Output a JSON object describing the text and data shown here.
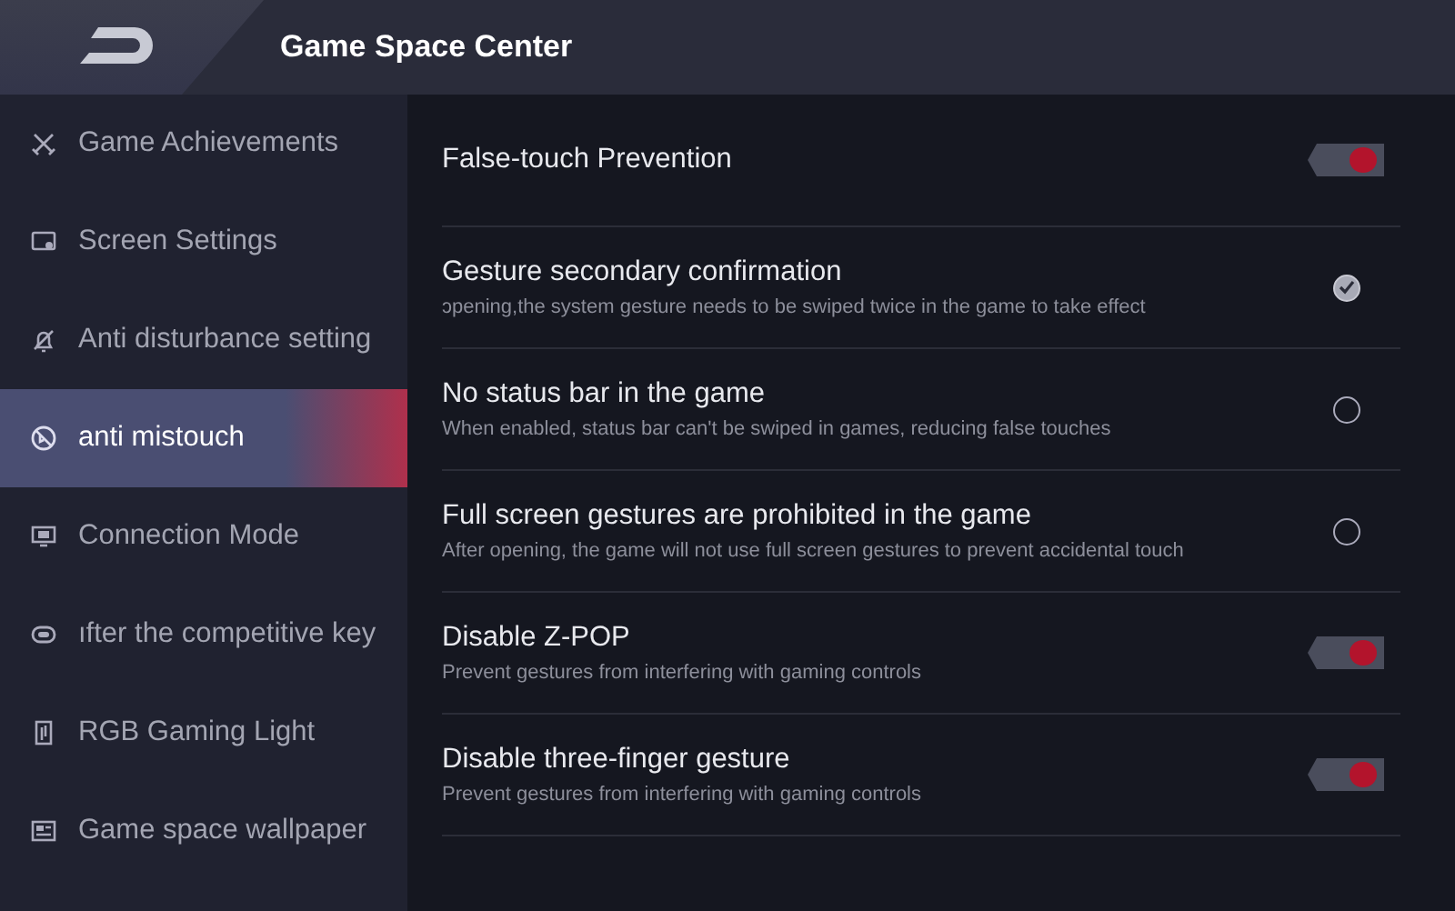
{
  "header": {
    "title": "Game Space Center"
  },
  "sidebar": {
    "items": [
      {
        "label": "Game Achievements",
        "selected": false
      },
      {
        "label": "Screen Settings",
        "selected": false
      },
      {
        "label": "Anti disturbance setting",
        "selected": false
      },
      {
        "label": "anti mistouch",
        "selected": true
      },
      {
        "label": "Connection Mode",
        "selected": false
      },
      {
        "label": "ıfter the competitive key",
        "selected": false
      },
      {
        "label": "RGB Gaming Light",
        "selected": false
      },
      {
        "label": "Game space wallpaper",
        "selected": false
      }
    ]
  },
  "settings": [
    {
      "kind": "toggle",
      "title": "False-touch Prevention",
      "on": true
    },
    {
      "kind": "check",
      "title": "Gesture secondary confirmation",
      "description": "ɔpening,the system gesture needs to be swiped twice in the game to take effect",
      "checked": true
    },
    {
      "kind": "check",
      "title": "No status bar in the game",
      "description": "When enabled, status bar can't be swiped in games, reducing false touches",
      "checked": false
    },
    {
      "kind": "check",
      "title": "Full screen gestures are prohibited in the game",
      "description": "After opening, the game will not use full screen gestures to prevent accidental touch",
      "checked": false
    },
    {
      "kind": "toggle",
      "title": "Disable Z-POP",
      "description": "Prevent gestures from interfering with gaming controls",
      "on": true
    },
    {
      "kind": "toggle",
      "title": "Disable three-finger gesture",
      "description": "Prevent gestures from interfering with gaming controls",
      "on": true
    }
  ]
}
